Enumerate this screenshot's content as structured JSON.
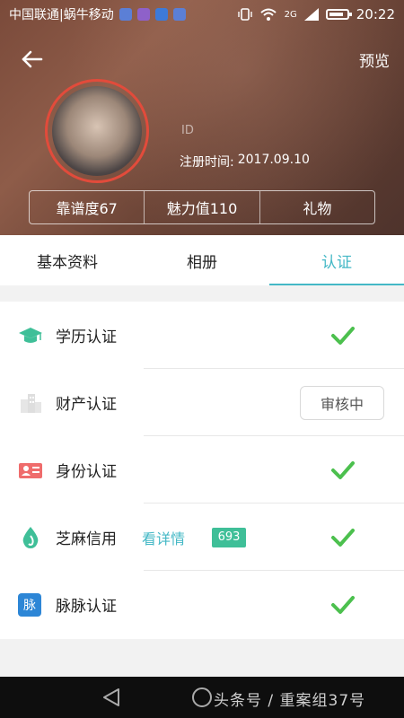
{
  "status_bar": {
    "carrier": "中国联通|蜗牛移动",
    "network": "2G",
    "time": "20:22"
  },
  "header": {
    "preview_label": "预览",
    "id_label": "ID",
    "register_label": "注册时间:",
    "register_date": "2017.09.10",
    "stats": [
      {
        "label": "靠谱度67"
      },
      {
        "label": "魅力值110"
      },
      {
        "label": "礼物"
      }
    ]
  },
  "tabs": [
    {
      "label": "基本资料",
      "active": false
    },
    {
      "label": "相册",
      "active": false
    },
    {
      "label": "认证",
      "active": true
    }
  ],
  "verifications": [
    {
      "icon": "graduation-cap-icon",
      "label": "学历认证",
      "status": "verified"
    },
    {
      "icon": "building-icon",
      "label": "财产认证",
      "status": "pending",
      "status_label": "审核中"
    },
    {
      "icon": "id-card-icon",
      "label": "身份认证",
      "status": "verified"
    },
    {
      "icon": "sesame-drop-icon",
      "label": "芝麻信用",
      "status": "verified",
      "detail_label": "看详情",
      "score": "693"
    },
    {
      "icon": "maimai-icon",
      "label": "脉脉认证",
      "status": "verified",
      "icon_text": "脉"
    }
  ],
  "colors": {
    "accent": "#44b8c6",
    "check": "#4cc04e",
    "score_badge": "#3fbf98",
    "avatar_ring": "#e24b3b"
  },
  "bottom_nav": {
    "watermark": "头条号 / 重案组37号"
  }
}
